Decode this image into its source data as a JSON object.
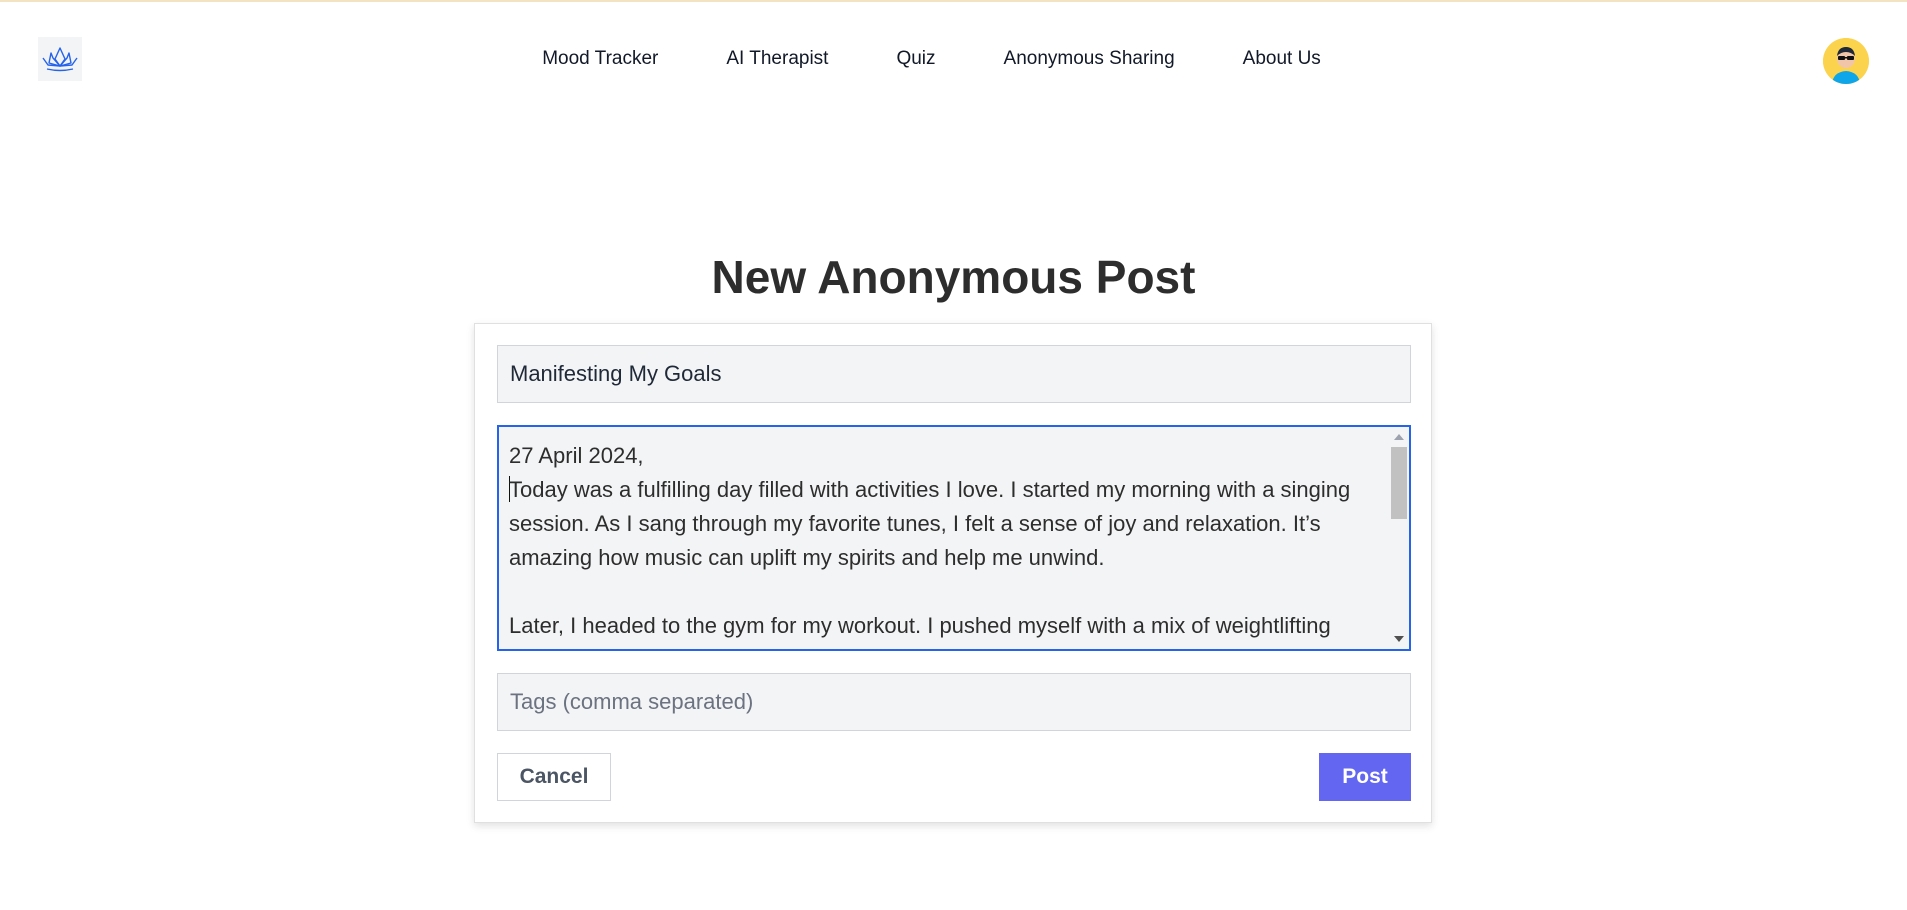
{
  "nav": {
    "items": [
      {
        "label": "Mood Tracker"
      },
      {
        "label": "AI Therapist"
      },
      {
        "label": "Quiz"
      },
      {
        "label": "Anonymous Sharing"
      },
      {
        "label": "About Us"
      }
    ]
  },
  "page": {
    "title": "New Anonymous Post"
  },
  "form": {
    "title_value": "Manifesting My Goals",
    "body_line1": "27 April 2024,",
    "body_rest": "Today was a fulfilling day filled with activities I love. I started my morning with a singing session. As I sang through my favorite tunes, I felt a sense of joy and relaxation. It’s amazing how music can uplift my spirits and help me unwind.\n\nLater, I headed to the gym for my workout. I pushed myself with a mix of weightlifting",
    "tags_placeholder": "Tags (comma separated)",
    "cancel_label": "Cancel",
    "post_label": "Post"
  },
  "colors": {
    "accent": "#6366f1",
    "focus_border": "#2563eb",
    "logo": "#2563eb",
    "avatar_bg": "#fcd34d"
  },
  "icons": {
    "logo": "lotus-icon",
    "avatar": "user-avatar-icon"
  }
}
